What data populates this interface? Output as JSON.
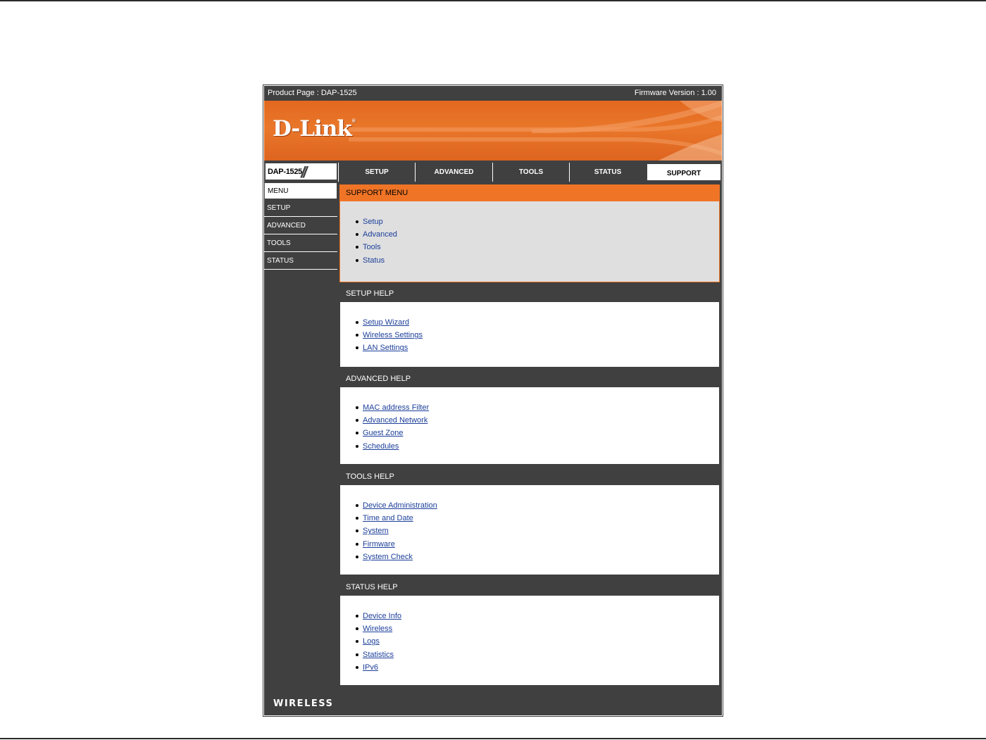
{
  "topbar": {
    "product_page": "Product Page : DAP-1525",
    "firmware": "Firmware Version : 1.00"
  },
  "brand": {
    "logo_text": "D-Link",
    "registered": "®",
    "accent": "#f07426",
    "dark": "#404040"
  },
  "nav": {
    "model": "DAP-1525",
    "tabs": [
      {
        "label": "SETUP"
      },
      {
        "label": "ADVANCED"
      },
      {
        "label": "TOOLS"
      },
      {
        "label": "STATUS"
      },
      {
        "label": "SUPPORT",
        "active": true
      }
    ]
  },
  "sidebar": {
    "items": [
      {
        "label": "MENU",
        "active": true
      },
      {
        "label": "SETUP"
      },
      {
        "label": "ADVANCED"
      },
      {
        "label": "TOOLS"
      },
      {
        "label": "STATUS"
      }
    ]
  },
  "sections": {
    "support_menu": {
      "title": "SUPPORT MENU",
      "links": [
        "Setup",
        "Advanced",
        "Tools",
        "Status"
      ]
    },
    "setup_help": {
      "title": "SETUP HELP",
      "links": [
        "Setup Wizard",
        "Wireless Settings",
        "LAN Settings"
      ]
    },
    "advanced_help": {
      "title": "ADVANCED HELP",
      "links": [
        "MAC address Filter",
        "Advanced Network",
        "Guest Zone",
        "Schedules"
      ]
    },
    "tools_help": {
      "title": "TOOLS HELP",
      "links": [
        "Device Administration",
        "Time and Date",
        "System",
        "Firmware",
        "System Check"
      ]
    },
    "status_help": {
      "title": "STATUS HELP",
      "links": [
        "Device Info",
        "Wireless",
        "Logs",
        "Statistics",
        "IPv6"
      ]
    }
  },
  "footer": {
    "label": "WIRELESS"
  }
}
